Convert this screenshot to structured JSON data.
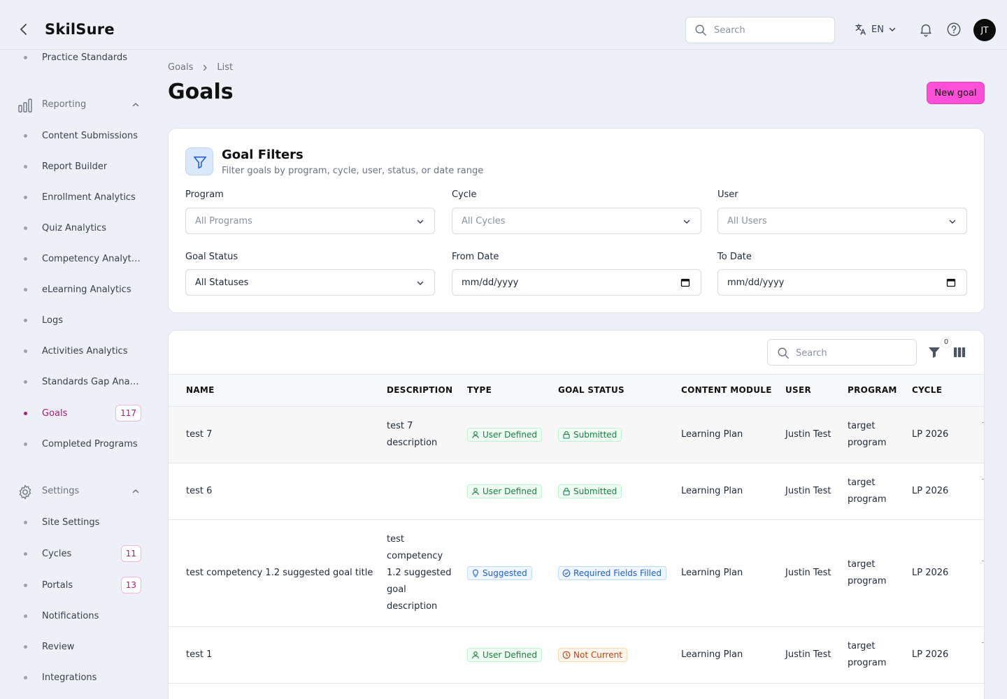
{
  "header": {
    "brand": "SkilSure",
    "search_placeholder": "Search",
    "lang": "EN",
    "avatar_initials": "JT"
  },
  "sidebar": {
    "top_item": "Practice Standards",
    "reporting": {
      "label": "Reporting",
      "items": [
        {
          "label": "Content Submissions"
        },
        {
          "label": "Report Builder"
        },
        {
          "label": "Enrollment Analytics"
        },
        {
          "label": "Quiz Analytics"
        },
        {
          "label": "Competency Analytics"
        },
        {
          "label": "eLearning Analytics"
        },
        {
          "label": "Logs"
        },
        {
          "label": "Activities Analytics"
        },
        {
          "label": "Standards Gap Analysis"
        },
        {
          "label": "Goals",
          "badge": "117"
        },
        {
          "label": "Completed Programs"
        }
      ]
    },
    "settings": {
      "label": "Settings",
      "items": [
        {
          "label": "Site Settings"
        },
        {
          "label": "Cycles",
          "badge": "11"
        },
        {
          "label": "Portals",
          "badge": "13"
        },
        {
          "label": "Notifications"
        },
        {
          "label": "Review"
        },
        {
          "label": "Integrations"
        }
      ]
    }
  },
  "breadcrumb": {
    "first": "Goals",
    "second": "List"
  },
  "page": {
    "title": "Goals",
    "new_button": "New goal"
  },
  "filters": {
    "title": "Goal Filters",
    "subtitle": "Filter goals by program, cycle, user, status, or date range",
    "program": {
      "label": "Program",
      "value": "All Programs"
    },
    "cycle": {
      "label": "Cycle",
      "value": "All Cycles"
    },
    "user": {
      "label": "User",
      "value": "All Users"
    },
    "status": {
      "label": "Goal Status",
      "value": "All Statuses"
    },
    "from_date": {
      "label": "From Date",
      "value": "mm/dd/yyyy"
    },
    "to_date": {
      "label": "To Date",
      "value": "mm/dd/yyyy"
    }
  },
  "table": {
    "search_placeholder": "Search",
    "filter_count": "0",
    "columns": [
      "NAME",
      "DESCRIPTION",
      "TYPE",
      "GOAL STATUS",
      "CONTENT MODULE",
      "USER",
      "PROGRAM",
      "CYCLE"
    ],
    "rows": [
      {
        "name": "test 7",
        "description": "test 7 description",
        "type": "User Defined",
        "status": "Submitted",
        "module": "Learning Plan",
        "user": "Justin Test",
        "program": "target program",
        "cycle": "LP 2026"
      },
      {
        "name": "test 6",
        "description": "",
        "type": "User Defined",
        "status": "Submitted",
        "module": "Learning Plan",
        "user": "Justin Test",
        "program": "target program",
        "cycle": "LP 2026"
      },
      {
        "name": "test competency 1.2 suggested goal title",
        "description": "test competency 1.2 suggested goal description",
        "type": "Suggested",
        "status": "Required Fields Filled",
        "module": "Learning Plan",
        "user": "Justin Test",
        "program": "target program",
        "cycle": "LP 2026"
      },
      {
        "name": "test 1",
        "description": "",
        "type": "User Defined",
        "status": "Not Current",
        "module": "Learning Plan",
        "user": "Justin Test",
        "program": "target program",
        "cycle": "LP 2026"
      }
    ]
  },
  "colors": {
    "accent": "#b01975",
    "primary_button": "#ff4fd8",
    "green_chip": "#15803d",
    "blue_chip": "#1d5fd1",
    "orange_chip": "#c2410c"
  }
}
